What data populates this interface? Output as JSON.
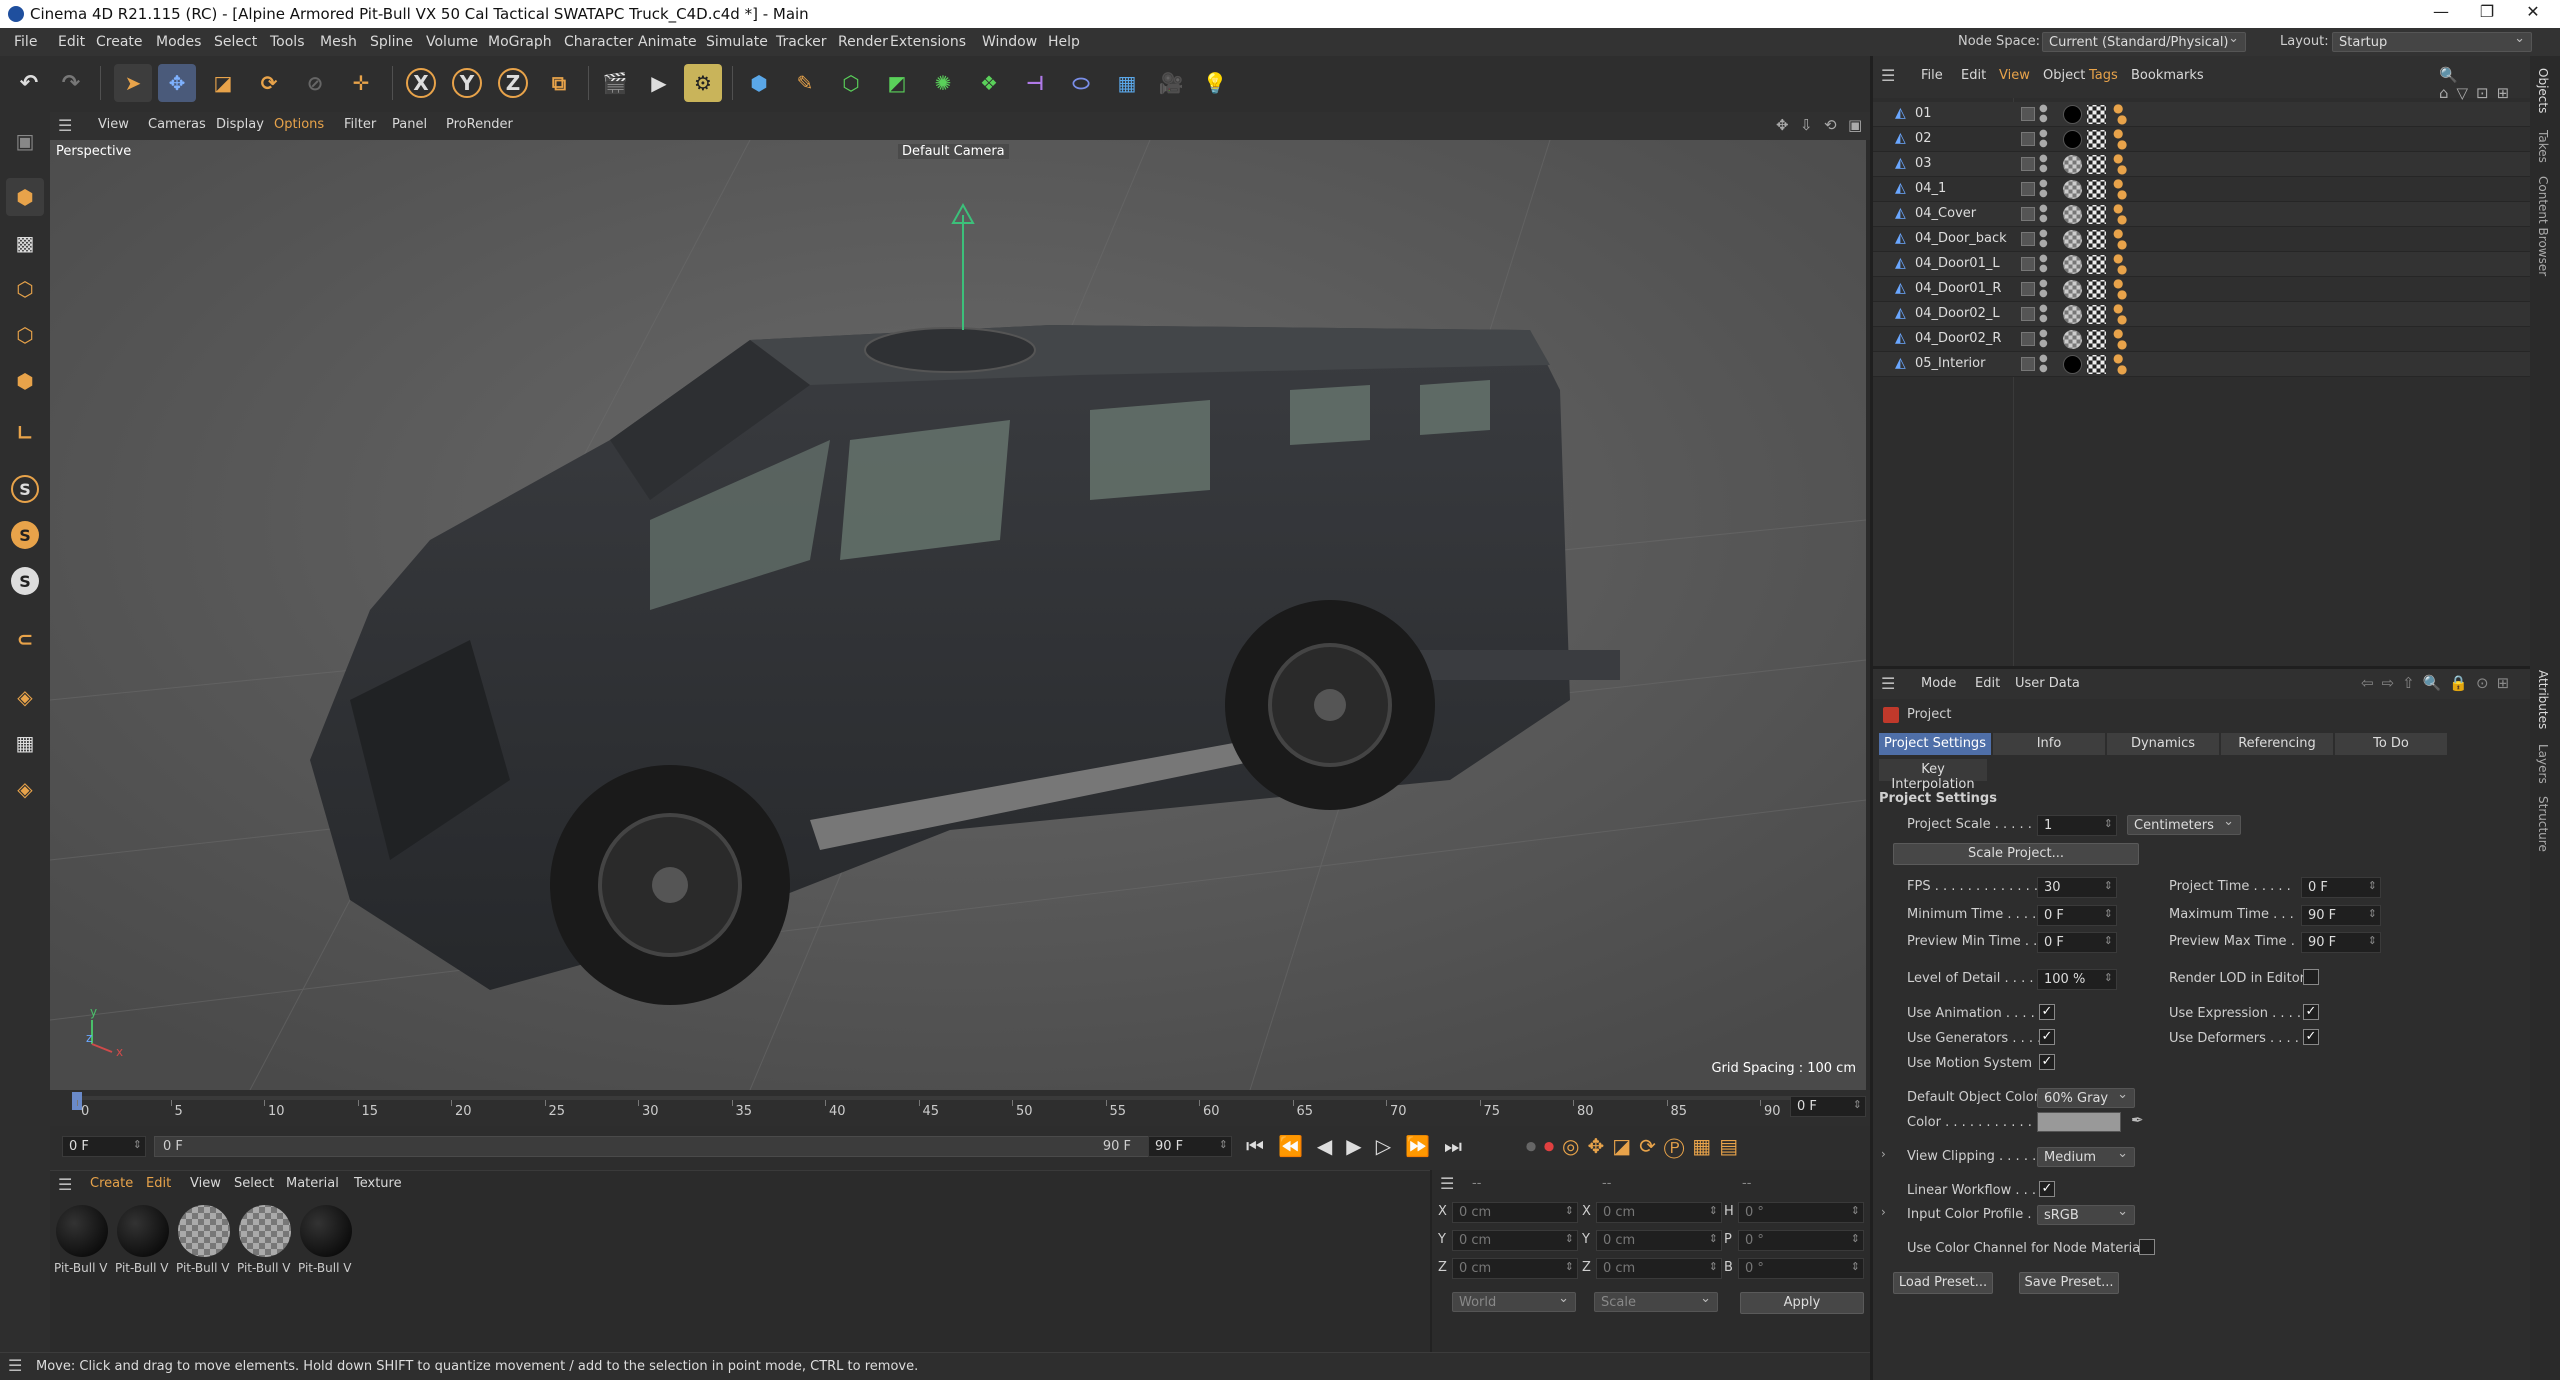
{
  "titlebar": {
    "title": "Cinema 4D R21.115 (RC) - [Alpine Armored Pit-Bull VX 50 Cal Tactical SWATAPC Truck_C4D.c4d *] - Main",
    "minimize": "—",
    "restore": "❐",
    "close": "✕"
  },
  "menubar": {
    "items": [
      "File",
      "Edit",
      "Create",
      "Modes",
      "Select",
      "Tools",
      "Mesh",
      "Spline",
      "Volume",
      "MoGraph",
      "Character",
      "Animate",
      "Simulate",
      "Tracker",
      "Render",
      "Extensions",
      "Window",
      "Help"
    ]
  },
  "nodebar": {
    "node_space_label": "Node Space:",
    "node_space_value": "Current (Standard/Physical)",
    "layout_label": "Layout:",
    "layout_value": "Startup"
  },
  "viewport_menu": {
    "items": [
      "View",
      "Cameras",
      "Display",
      "Options",
      "Filter",
      "Panel",
      "ProRender"
    ]
  },
  "viewport": {
    "name": "Perspective",
    "camera": "Default Camera",
    "grid_spacing": "Grid Spacing : 100 cm"
  },
  "timeline": {
    "ticks": [
      "0",
      "5",
      "10",
      "15",
      "20",
      "25",
      "30",
      "35",
      "40",
      "45",
      "50",
      "55",
      "60",
      "65",
      "70",
      "75",
      "80",
      "85",
      "90"
    ],
    "current_frame": "0 F"
  },
  "transport": {
    "start": "0 F",
    "range_start": "0 F",
    "range_end": "90 F",
    "end": "90 F"
  },
  "materials": {
    "menu": [
      "Create",
      "Edit",
      "View",
      "Select",
      "Material",
      "Texture"
    ],
    "items": [
      {
        "name": "Pit-Bull V",
        "type": "black"
      },
      {
        "name": "Pit-Bull V",
        "type": "black"
      },
      {
        "name": "Pit-Bull V",
        "type": "checker"
      },
      {
        "name": "Pit-Bull V",
        "type": "checker"
      },
      {
        "name": "Pit-Bull V",
        "type": "black"
      }
    ]
  },
  "coords": {
    "header1": "--",
    "header2": "--",
    "header3": "--",
    "rows": [
      {
        "a": "X",
        "av": "0 cm",
        "b": "X",
        "bv": "0 cm",
        "c": "H",
        "cv": "0 °"
      },
      {
        "a": "Y",
        "av": "0 cm",
        "b": "Y",
        "bv": "0 cm",
        "c": "P",
        "cv": "0 °"
      },
      {
        "a": "Z",
        "av": "0 cm",
        "b": "Z",
        "bv": "0 cm",
        "c": "B",
        "cv": "0 °"
      }
    ],
    "world": "World",
    "scale": "Scale",
    "apply": "Apply"
  },
  "status": {
    "text": "Move: Click and drag to move elements. Hold down SHIFT to quantize movement / add to the selection in point mode, CTRL to remove."
  },
  "objects": {
    "menu": [
      "File",
      "Edit",
      "View",
      "Object",
      "Tags",
      "Bookmarks"
    ],
    "items": [
      {
        "name": "01",
        "mat": "black"
      },
      {
        "name": "02",
        "mat": "black"
      },
      {
        "name": "03",
        "mat": "checker"
      },
      {
        "name": "04_1",
        "mat": "checker"
      },
      {
        "name": "04_Cover",
        "mat": "checker"
      },
      {
        "name": "04_Door_back",
        "mat": "checker"
      },
      {
        "name": "04_Door01_L",
        "mat": "checker"
      },
      {
        "name": "04_Door01_R",
        "mat": "checker"
      },
      {
        "name": "04_Door02_L",
        "mat": "checker"
      },
      {
        "name": "04_Door02_R",
        "mat": "checker"
      },
      {
        "name": "05_Interior",
        "mat": "black"
      }
    ]
  },
  "attributes": {
    "menu": [
      "Mode",
      "Edit",
      "User Data"
    ],
    "object_label": "Project",
    "tabs": [
      "Project Settings",
      "Info",
      "Dynamics",
      "Referencing",
      "To Do"
    ],
    "tab2": "Key Interpolation",
    "section": "Project Settings",
    "project_scale_label": "Project Scale . . . . . .",
    "project_scale_value": "1",
    "project_scale_unit": "Centimeters",
    "scale_project_btn": "Scale Project...",
    "fps_label": "FPS . . . . . . . . . . . . . .",
    "fps_value": "30",
    "project_time_label": "Project Time . . . . .",
    "project_time_value": "0 F",
    "min_time_label": "Minimum Time . . . .",
    "min_time_value": "0 F",
    "max_time_label": "Maximum Time . . .",
    "max_time_value": "90 F",
    "prev_min_label": "Preview Min Time . .",
    "prev_min_value": "0 F",
    "prev_max_label": "Preview Max Time .",
    "prev_max_value": "90 F",
    "lod_label": "Level of Detail . . . . .",
    "lod_value": "100 %",
    "render_lod_label": "Render LOD in Editor",
    "use_anim_label": "Use Animation . . . . .",
    "use_expr_label": "Use Expression . . . .",
    "use_gen_label": "Use Generators . . . .",
    "use_def_label": "Use Deformers . . . .",
    "use_motion_label": "Use Motion System",
    "default_color_label": "Default Object Color",
    "default_color_value": "60% Gray",
    "color_label": "Color . . . . . . . . . . . . .",
    "view_clip_label": "View Clipping . . . . . .",
    "view_clip_value": "Medium",
    "linear_label": "Linear Workflow . . . .",
    "input_profile_label": "Input Color Profile . . .",
    "input_profile_value": "sRGB",
    "color_channel_label": "Use Color Channel for Node Material",
    "load_preset": "Load Preset...",
    "save_preset": "Save Preset..."
  },
  "sidetabs": {
    "top": [
      "Objects",
      "Takes",
      "Content Browser"
    ],
    "bottom": [
      "Attributes",
      "Layers",
      "Structure"
    ]
  }
}
